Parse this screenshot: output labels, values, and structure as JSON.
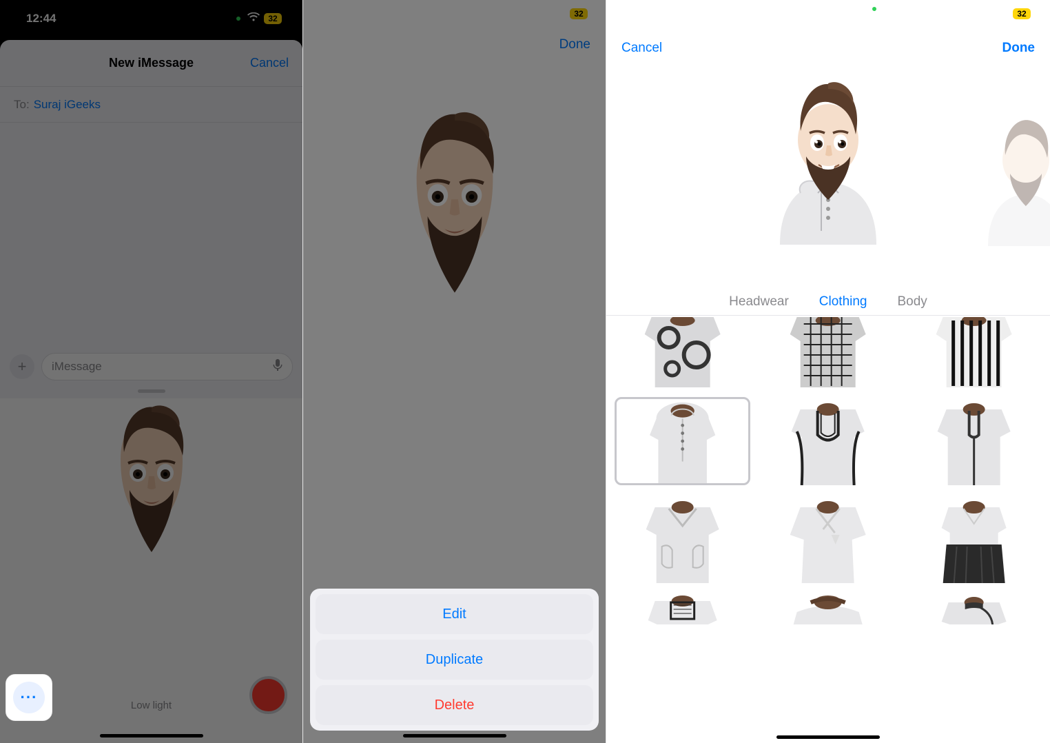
{
  "phone1": {
    "status": {
      "time": "12:44",
      "battery": "32"
    },
    "title": "New iMessage",
    "cancel": "Cancel",
    "to_label": "To:",
    "to_value": "Suraj iGeeks",
    "input_placeholder": "iMessage",
    "low_light": "Low light",
    "options_icon": "···"
  },
  "phone2": {
    "status": {
      "battery": "32"
    },
    "done": "Done",
    "actions": {
      "edit": "Edit",
      "duplicate": "Duplicate",
      "delete": "Delete"
    }
  },
  "phone3": {
    "status": {
      "battery": "32"
    },
    "cancel": "Cancel",
    "done": "Done",
    "tabs": {
      "headwear": "Headwear",
      "clothing": "Clothing",
      "body": "Body"
    },
    "active_tab": "clothing",
    "clothing_items": [
      "pattern-circles",
      "pattern-geometric",
      "pattern-stripes",
      "hoodie-buttons",
      "tunic-embroidered",
      "tunic-piping",
      "robe-pockets",
      "hanbok",
      "hakama",
      "blouse-square",
      "top-offshoulder",
      "cheongsam"
    ],
    "selected_item": "hoodie-buttons"
  }
}
